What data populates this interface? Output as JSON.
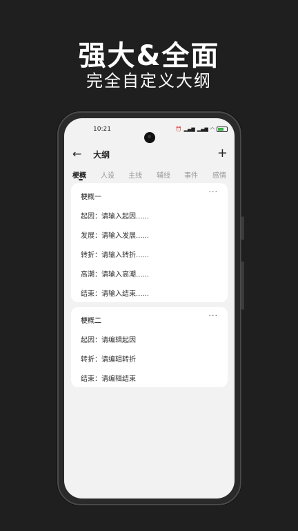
{
  "promo": {
    "headline": "强大&全面",
    "subhead": "完全自定义大纲"
  },
  "status_bar": {
    "time": "10:21",
    "battery": "80"
  },
  "appbar": {
    "title": "大纲",
    "back_icon": "arrow-left-icon",
    "add_icon": "plus-icon"
  },
  "tabs": [
    {
      "label": "梗概",
      "active": true
    },
    {
      "label": "人设"
    },
    {
      "label": "主线"
    },
    {
      "label": "辅线"
    },
    {
      "label": "事件"
    },
    {
      "label": "感情"
    }
  ],
  "cards": [
    {
      "title": "梗概一",
      "rows": [
        "起因：请输入起因......",
        "发展：请输入发展......",
        "转折：请输入转折......",
        "高潮：请输入高潮......",
        "结束：请输入结束......"
      ]
    },
    {
      "title": "梗概二",
      "rows": [
        "起因：请编辑起因",
        "转折：请编辑转折",
        "结束：请编辑结束"
      ]
    }
  ]
}
